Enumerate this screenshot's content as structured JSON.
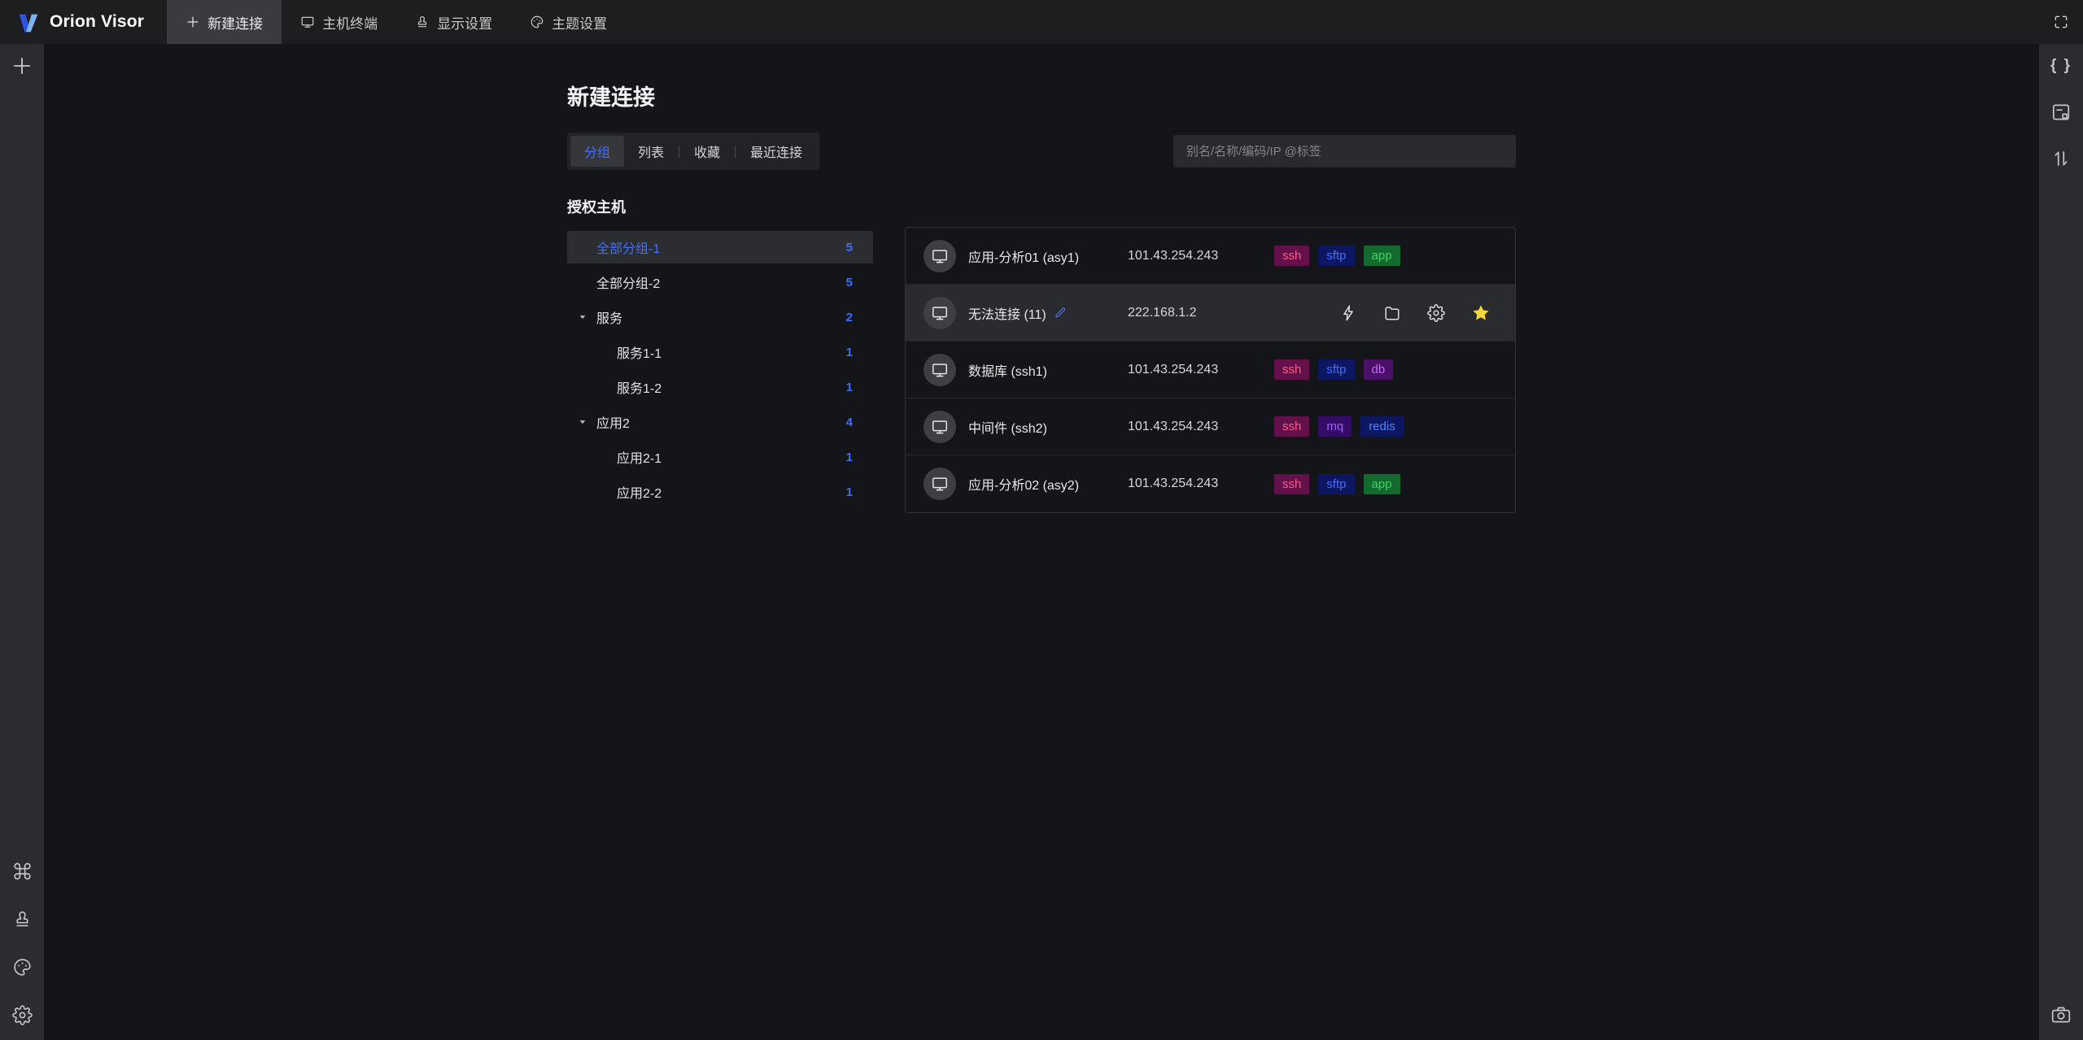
{
  "topbar": {
    "brand": "Orion Visor",
    "tabs": [
      {
        "label": "新建连接",
        "icon": "plus-icon",
        "active": true
      },
      {
        "label": "主机终端",
        "icon": "monitor-icon",
        "active": false
      },
      {
        "label": "显示设置",
        "icon": "stamp-icon",
        "active": false
      },
      {
        "label": "主题设置",
        "icon": "palette-icon",
        "active": false
      }
    ],
    "fullscreen_icon": "fullscreen-icon"
  },
  "left_sidebar": {
    "top_icons": [
      {
        "icon": "plus-icon"
      }
    ],
    "bottom_icons": [
      {
        "icon": "command-icon"
      },
      {
        "icon": "stamp-icon"
      },
      {
        "icon": "palette-icon"
      },
      {
        "icon": "gear-icon"
      }
    ]
  },
  "right_sidebar": {
    "top_icons": [
      {
        "icon": "braces-icon"
      },
      {
        "icon": "form-doc-icon"
      },
      {
        "icon": "sort-vertical-icon"
      }
    ],
    "bottom_icons": [
      {
        "icon": "camera-icon"
      }
    ]
  },
  "main": {
    "title": "新建连接",
    "view_tabs": [
      {
        "label": "分组",
        "active": true
      },
      {
        "label": "列表",
        "active": false
      },
      {
        "label": "收藏",
        "active": false
      },
      {
        "label": "最近连接",
        "active": false
      }
    ],
    "search": {
      "placeholder": "别名/名称/编码/IP @标签"
    },
    "tree": {
      "header": "授权主机",
      "items": [
        {
          "label": "全部分组-1",
          "count": "5",
          "level": 1,
          "expandable": false,
          "selected": true
        },
        {
          "label": "全部分组-2",
          "count": "5",
          "level": 1,
          "expandable": false,
          "selected": false
        },
        {
          "label": "服务",
          "count": "2",
          "level": 1,
          "expandable": true,
          "selected": false
        },
        {
          "label": "服务1-1",
          "count": "1",
          "level": 2,
          "expandable": false,
          "selected": false
        },
        {
          "label": "服务1-2",
          "count": "1",
          "level": 2,
          "expandable": false,
          "selected": false
        },
        {
          "label": "应用2",
          "count": "4",
          "level": 1,
          "expandable": true,
          "selected": false
        },
        {
          "label": "应用2-1",
          "count": "1",
          "level": 2,
          "expandable": false,
          "selected": false
        },
        {
          "label": "应用2-2",
          "count": "1",
          "level": 2,
          "expandable": false,
          "selected": false
        }
      ]
    },
    "hosts": [
      {
        "name": "应用-分析01 (asy1)",
        "ip": "101.43.254.243",
        "tags": [
          "ssh",
          "sftp",
          "app"
        ],
        "hovered": false,
        "editable": false,
        "actions": []
      },
      {
        "name": "无法连接 (11)",
        "ip": "222.168.1.2",
        "tags": [],
        "hovered": true,
        "editable": true,
        "actions": [
          {
            "icon": "lightning-icon",
            "starred": false
          },
          {
            "icon": "folder-icon",
            "starred": false
          },
          {
            "icon": "gear-icon",
            "starred": false
          },
          {
            "icon": "star-icon",
            "starred": true
          }
        ]
      },
      {
        "name": "数据库 (ssh1)",
        "ip": "101.43.254.243",
        "tags": [
          "ssh",
          "sftp",
          "db"
        ],
        "hovered": false,
        "editable": false,
        "actions": []
      },
      {
        "name": "中间件 (ssh2)",
        "ip": "101.43.254.243",
        "tags": [
          "ssh",
          "mq",
          "redis"
        ],
        "hovered": false,
        "editable": false,
        "actions": []
      },
      {
        "name": "应用-分析02 (asy2)",
        "ip": "101.43.254.243",
        "tags": [
          "ssh",
          "sftp",
          "app"
        ],
        "hovered": false,
        "editable": false,
        "actions": []
      }
    ]
  },
  "tag_styles": {
    "ssh": {
      "bg": "#63104b",
      "fg": "#ff5c8d"
    },
    "sftp": {
      "bg": "#0d1660",
      "fg": "#3f6fff"
    },
    "app": {
      "bg": "#126a2e",
      "fg": "#3fd463"
    },
    "db": {
      "bg": "#4b1068",
      "fg": "#c769ff"
    },
    "mq": {
      "bg": "#340b66",
      "fg": "#9a60ff"
    },
    "redis": {
      "bg": "#0d1660",
      "fg": "#4a85ff"
    }
  },
  "colors": {
    "accent": "#3b6eff",
    "star": "#f5d63d",
    "topbar_bg": "#1d1e20",
    "sidebar_bg": "#2a2c2f",
    "main_bg": "#141518",
    "active_tab_bg": "#3a3b3e"
  }
}
